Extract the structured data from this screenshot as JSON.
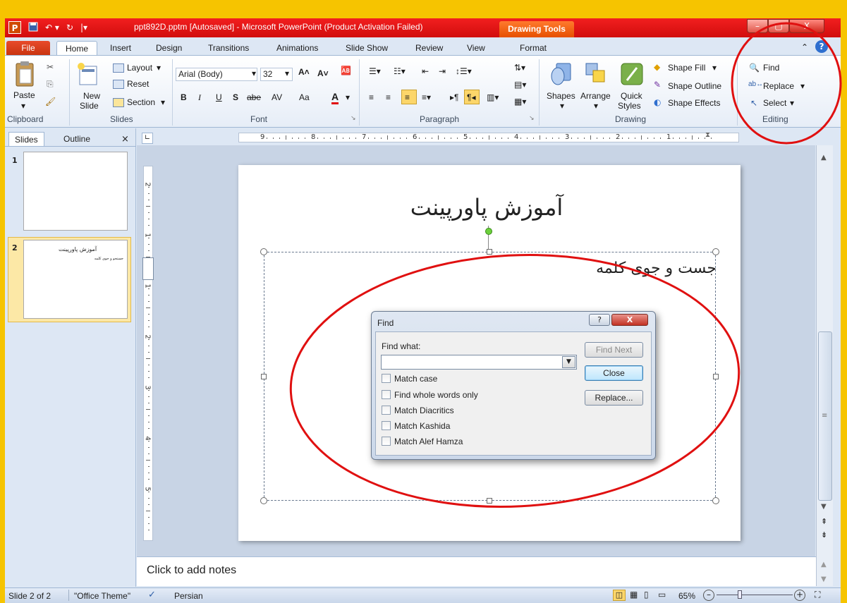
{
  "window": {
    "title": "ppt892D.pptm [Autosaved]  -  Microsoft PowerPoint (Product Activation Failed)",
    "contextual_tab_group": "Drawing Tools"
  },
  "tabs": {
    "file": "File",
    "items": [
      "Home",
      "Insert",
      "Design",
      "Transitions",
      "Animations",
      "Slide Show",
      "Review",
      "View",
      "Format"
    ],
    "active": "Home"
  },
  "ribbon": {
    "clipboard": {
      "paste": "Paste",
      "group": "Clipboard"
    },
    "slides": {
      "layout": "Layout",
      "reset": "Reset",
      "section": "Section",
      "new_slide_1": "New",
      "new_slide_2": "Slide",
      "group": "Slides"
    },
    "font": {
      "font_name": "Arial (Body)",
      "font_size": "32",
      "bold": "B",
      "italic": "I",
      "underline": "U",
      "shadow": "S",
      "strike": "abe",
      "spacing": "AV",
      "case": "Aa",
      "group": "Font"
    },
    "paragraph": {
      "group": "Paragraph"
    },
    "drawing": {
      "shapes": "Shapes",
      "arrange": "Arrange",
      "quick_1": "Quick",
      "quick_2": "Styles",
      "fill": "Shape Fill",
      "outline": "Shape Outline",
      "effects": "Shape Effects",
      "group": "Drawing"
    },
    "editing": {
      "find": "Find",
      "replace": "Replace",
      "select": "Select",
      "group": "Editing"
    }
  },
  "left_panel": {
    "tab_slides": "Slides",
    "tab_outline": "Outline",
    "slide1_num": "1",
    "slide2_num": "2",
    "slide2_title": "آموزش پاورپینت",
    "slide2_body": "جستجو و جوی کلمه"
  },
  "slide": {
    "title": "آموزش پاورپینت",
    "body": "جست و جوی کلمه"
  },
  "ruler": {
    "h_ticks": [
      "9",
      "8",
      "7",
      "6",
      "5",
      "4",
      "3",
      "2",
      "1"
    ],
    "v_ticks": [
      "2",
      "1",
      "1",
      "2",
      "3",
      "4",
      "5"
    ]
  },
  "find_dialog": {
    "title": "Find",
    "help": "?",
    "close_x": "X",
    "find_what_label": "Find what:",
    "find_what_value": "",
    "find_next": "Find Next",
    "close": "Close",
    "replace": "Replace...",
    "options": [
      "Match case",
      "Find whole words only",
      "Match Diacritics",
      "Match Kashida",
      "Match Alef Hamza"
    ]
  },
  "notes": {
    "placeholder": "Click to add notes"
  },
  "status": {
    "slide": "Slide 2 of 2",
    "theme": "\"Office Theme\"",
    "language": "Persian",
    "zoom": "65%"
  },
  "colors": {
    "title_bar": "#e01818",
    "file_tab": "#d43b16",
    "drawing_tools": "#f06010",
    "annotation": "#e01010"
  }
}
